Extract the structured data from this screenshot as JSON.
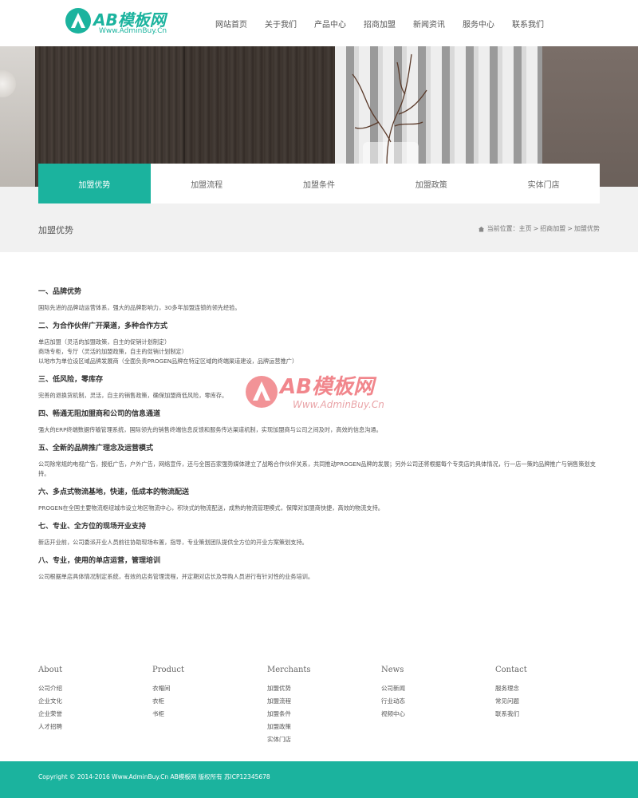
{
  "header": {
    "logo_text": "AB模板网",
    "logo_sub": "Www.AdminBuy.Cn",
    "nav": [
      "网站首页",
      "关于我们",
      "产品中心",
      "招商加盟",
      "新闻资讯",
      "服务中心",
      "联系我们"
    ]
  },
  "tabs": [
    {
      "label": "加盟优势",
      "active": true
    },
    {
      "label": "加盟流程",
      "active": false
    },
    {
      "label": "加盟条件",
      "active": false
    },
    {
      "label": "加盟政策",
      "active": false
    },
    {
      "label": "实体门店",
      "active": false
    }
  ],
  "page": {
    "title": "加盟优势",
    "breadcrumb": [
      "当前位置：",
      "主页",
      ">",
      "招商加盟",
      ">",
      "加盟优势"
    ]
  },
  "content": [
    {
      "heading": "一、品牌优势",
      "lines": [
        "国际先进的品牌动运营体系，强大的品牌影响力，30多年加盟连锁的领先经验。"
      ]
    },
    {
      "heading": "二、为合作伙伴广开渠道，多种合作方式",
      "lines": [
        "单店加盟（灵活的加盟政策，自主的促销计划制定）",
        "商场专柜，专厅（灵活的加盟政策，自主的促销计划制定）",
        "以地市为单位设区域品牌发展商（全面负责PROGEN品牌在特定区域的终端渠道建设，品牌运营推广）"
      ]
    },
    {
      "heading": "三、低风险，零库存",
      "lines": [
        "完善的退换货机制，灵活，自主的销售政策，确保加盟商低风险，零库存。"
      ]
    },
    {
      "heading": "四、畅通无阻加盟商和公司的信息通道",
      "lines": [
        "强大的ERP终端数据传输管理系统，国际领先的销售终端信息反馈和服务传达渠道机制，实现加盟商与公司之间及时，高效的信息沟通。"
      ]
    },
    {
      "heading": "五、全新的品牌推广理念及运营模式",
      "lines": [
        "公司除常规的电视广告，报纸广告，户外广告，网络宣传，还与全国百家强势媒体建立了战略合作伙伴关系，共同推动PROGEN品牌的发展；另外公司还将根据每个专卖店的具体情况，行一店一策的品牌推广与销售策划支持。"
      ]
    },
    {
      "heading": "六、多点式物流基地，快速，低成本的物流配送",
      "lines": [
        "PROGEN在全国主要物流枢纽城市设立地区物流中心，积块式的物流配送，成熟的物流管理模式，保障对加盟商快捷，高效的物流支持。"
      ]
    },
    {
      "heading": "七、专业、全方位的现场开业支持",
      "lines": [
        "新店开业前，公司委派开业人员前往协助现场布置，指导，专业策划团队提供全方位的开业方案策划支持。"
      ]
    },
    {
      "heading": "八、专业，使用的单店运营，管理培训",
      "lines": [
        "公司根据单店具体情况制定系统，有效的店务管理流程，并定期对店长及导购人员进行有针对性的业务培训。"
      ]
    }
  ],
  "watermark": {
    "text": "AB模板网",
    "sub": "Www.AdminBuy.Cn"
  },
  "footer": {
    "columns": [
      {
        "title": "About",
        "items": [
          "公司介绍",
          "企业文化",
          "企业荣誉",
          "人才招聘"
        ]
      },
      {
        "title": "Product",
        "items": [
          "衣帽间",
          "衣柜",
          "书柜"
        ]
      },
      {
        "title": "Merchants",
        "items": [
          "加盟优势",
          "加盟流程",
          "加盟条件",
          "加盟政策",
          "实体门店"
        ]
      },
      {
        "title": "News",
        "items": [
          "公司新闻",
          "行业动态",
          "视频中心"
        ]
      },
      {
        "title": "Contact",
        "items": [
          "服务理念",
          "常见问题",
          "联系我们"
        ]
      }
    ],
    "copyright": "Copyright © 2014-2016 Www.AdminBuy.Cn AB模板网 版权所有 苏ICP12345678"
  },
  "colors": {
    "accent": "#1bb39e"
  }
}
